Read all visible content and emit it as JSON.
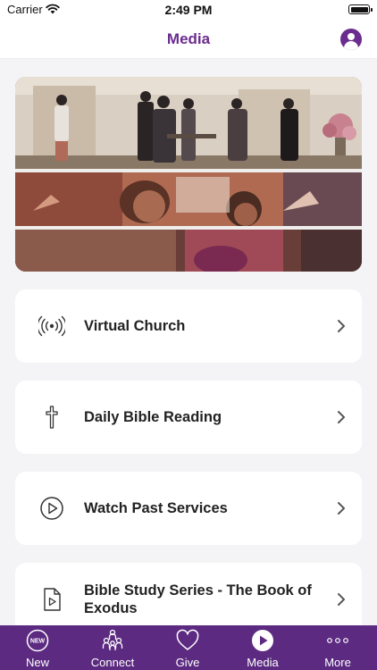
{
  "status_bar": {
    "carrier": "Carrier",
    "time": "2:49 PM"
  },
  "nav": {
    "title": "Media",
    "profile_icon": "person-circle-icon"
  },
  "banner": {
    "description_icon": "church-service-photo-collage"
  },
  "menu": [
    {
      "label": "Virtual Church",
      "icon": "broadcast-icon"
    },
    {
      "label": "Daily Bible Reading",
      "icon": "cross-icon"
    },
    {
      "label": "Watch Past Services",
      "icon": "play-circle-icon"
    },
    {
      "label": "Bible Study Series - The Book of Exodus",
      "icon": "video-file-icon"
    }
  ],
  "tabs": [
    {
      "label": "New",
      "icon": "new-badge-icon",
      "badge": "NEW"
    },
    {
      "label": "Connect",
      "icon": "people-icon"
    },
    {
      "label": "Give",
      "icon": "heart-icon"
    },
    {
      "label": "Media",
      "icon": "play-circle-filled-icon"
    },
    {
      "label": "More",
      "icon": "ellipsis-icon"
    }
  ],
  "colors": {
    "brand_purple": "#6b2c8f",
    "tab_bar": "#5c2a80",
    "background": "#f4f4f6"
  }
}
